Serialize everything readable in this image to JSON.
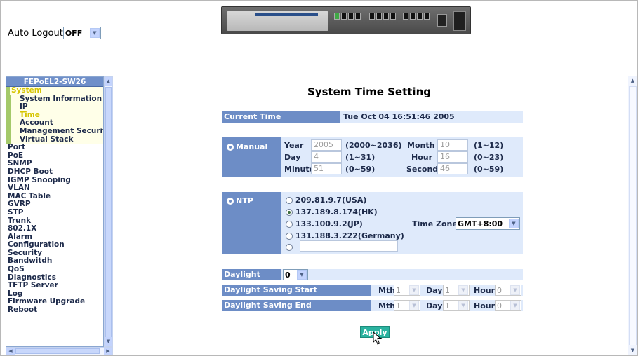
{
  "header": {
    "auto_logout_label": "Auto Logout",
    "auto_logout_value": "OFF"
  },
  "nav": {
    "title": "FEPoEL2-SW26",
    "items": [
      {
        "label": "System",
        "level": "top-active"
      },
      {
        "label": "System Information",
        "level": "sub"
      },
      {
        "label": "IP",
        "level": "sub"
      },
      {
        "label": "Time",
        "level": "sub-active"
      },
      {
        "label": "Account",
        "level": "sub"
      },
      {
        "label": "Management Securit",
        "level": "sub"
      },
      {
        "label": "Virtual Stack",
        "level": "sub"
      },
      {
        "label": "Port",
        "level": "top"
      },
      {
        "label": "PoE",
        "level": "top"
      },
      {
        "label": "SNMP",
        "level": "top"
      },
      {
        "label": "DHCP Boot",
        "level": "top"
      },
      {
        "label": "IGMP Snooping",
        "level": "top"
      },
      {
        "label": "VLAN",
        "level": "top"
      },
      {
        "label": "MAC Table",
        "level": "top"
      },
      {
        "label": "GVRP",
        "level": "top"
      },
      {
        "label": "STP",
        "level": "top"
      },
      {
        "label": "Trunk",
        "level": "top"
      },
      {
        "label": "802.1X",
        "level": "top"
      },
      {
        "label": "Alarm",
        "level": "top"
      },
      {
        "label": "Configuration",
        "level": "top"
      },
      {
        "label": "Security",
        "level": "top"
      },
      {
        "label": "Bandwitdh",
        "level": "top"
      },
      {
        "label": "QoS",
        "level": "top"
      },
      {
        "label": "Diagnostics",
        "level": "top"
      },
      {
        "label": "TFTP Server",
        "level": "top"
      },
      {
        "label": "Log",
        "level": "top"
      },
      {
        "label": "Firmware Upgrade",
        "level": "top"
      },
      {
        "label": "Reboot",
        "level": "top"
      }
    ]
  },
  "main": {
    "title": "System Time Setting",
    "current_time_label": "Current Time",
    "current_time_value": "Tue Oct 04 16:51:46 2005",
    "manual": {
      "label": "Manual",
      "year_label": "Year",
      "year_value": "2005",
      "year_range": "(2000~2036)",
      "month_label": "Month",
      "month_value": "10",
      "month_range": "(1~12)",
      "day_label": "Day",
      "day_value": "4",
      "day_range": "(1~31)",
      "hour_label": "Hour",
      "hour_value": "16",
      "hour_range": "(0~23)",
      "minute_label": "Minute",
      "minute_value": "51",
      "minute_range": "(0~59)",
      "second_label": "Second",
      "second_value": "46",
      "second_range": "(0~59)"
    },
    "ntp": {
      "label": "NTP",
      "servers": [
        "209.81.9.7(USA)",
        "137.189.8.174(HK)",
        "133.100.9.2(JP)",
        "131.188.3.222(Germany)"
      ],
      "selected_index": 1,
      "custom_value": "",
      "time_zone_label": "Time Zone",
      "time_zone_value": "GMT+8:00"
    },
    "daylight": {
      "saving_label": "Daylight Saving",
      "saving_value": "0",
      "start_label": "Daylight Saving Start",
      "end_label": "Daylight Saving End",
      "mth_label": "Mth",
      "day_label": "Day",
      "hour_label": "Hour",
      "start_mth": "1",
      "start_day": "1",
      "start_hour": "0",
      "end_mth": "1",
      "end_day": "1",
      "end_hour": "0"
    },
    "apply_label": "Apply"
  }
}
